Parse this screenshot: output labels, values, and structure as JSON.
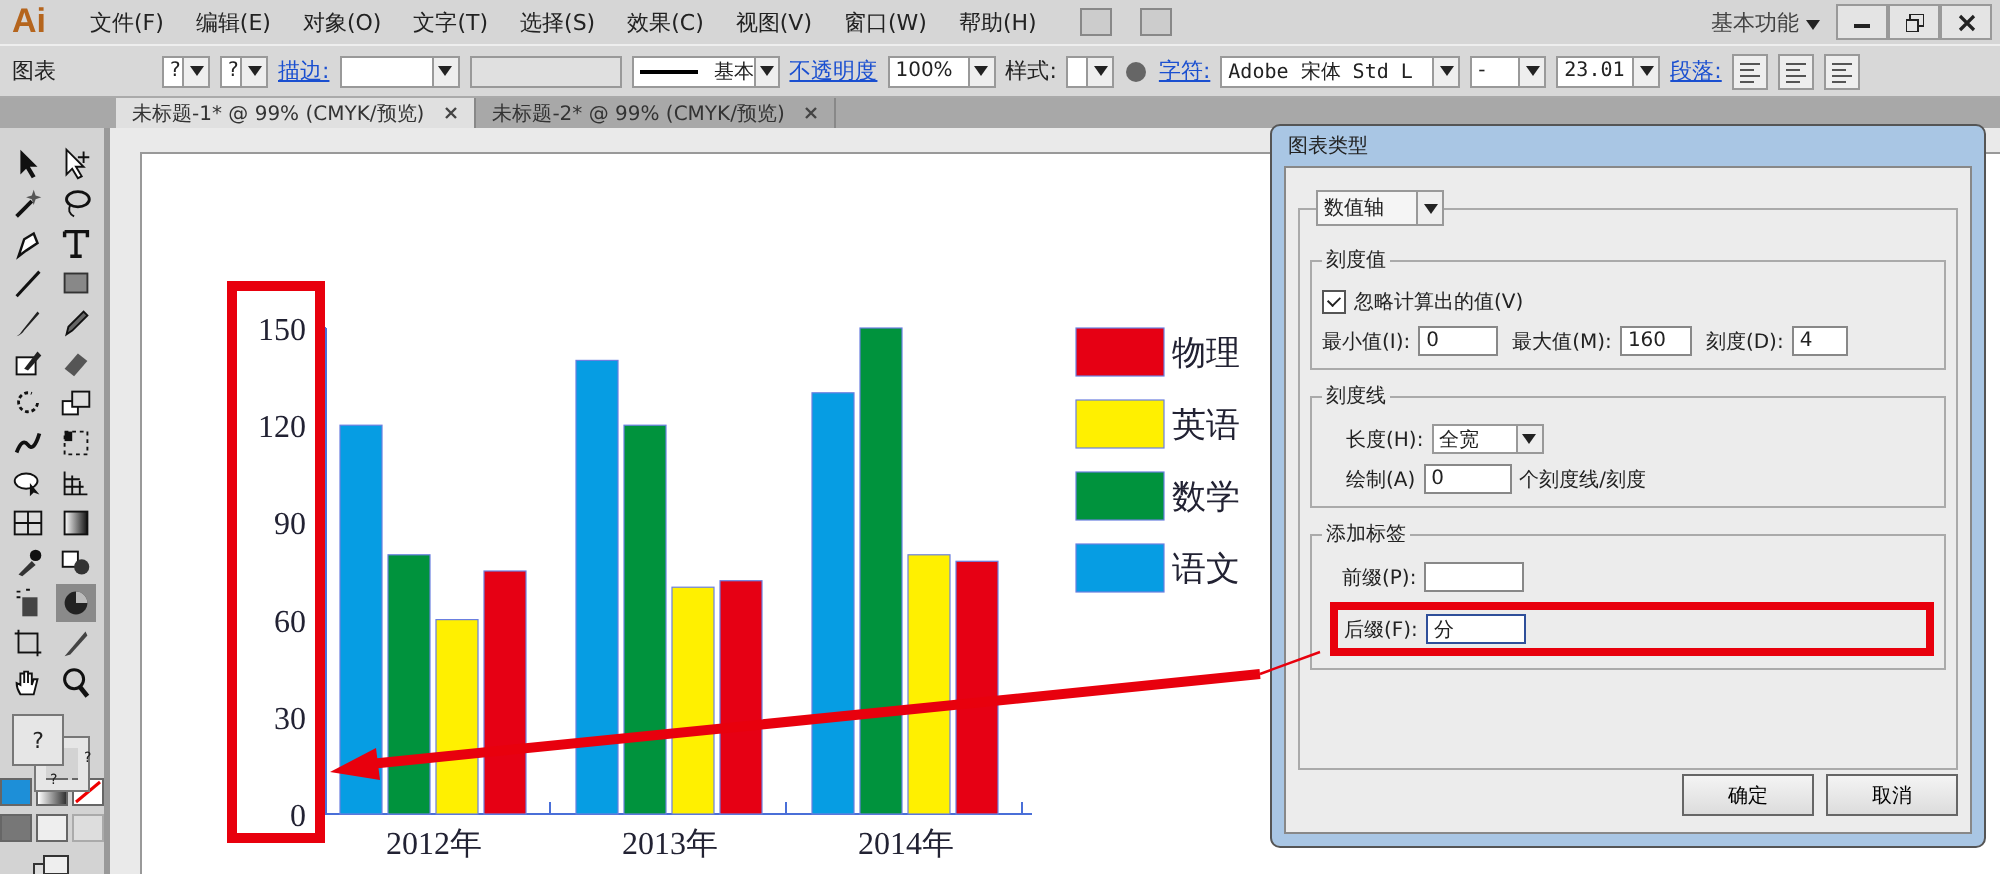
{
  "app": {
    "logo": "Ai",
    "menu": [
      "文件(F)",
      "编辑(E)",
      "对象(O)",
      "文字(T)",
      "选择(S)",
      "效果(C)",
      "视图(V)",
      "窗口(W)",
      "帮助(H)"
    ],
    "workspace": "基本功能"
  },
  "control_bar": {
    "object": "图表",
    "graph_menu_1": "?",
    "graph_menu_2": "?",
    "stroke_link": "描边:",
    "stroke_style": "基本",
    "opacity_link": "不透明度",
    "opacity": "100%",
    "style_label": "样式:",
    "char_link": "字符:",
    "font": "Adobe 宋体 Std L",
    "font_style": "-",
    "font_size": "23.01",
    "para_link": "段落:"
  },
  "tabs": [
    {
      "label": "未标题-1* @ 99% (CMYK/预览)",
      "selected": true
    },
    {
      "label": "未标题-2* @ 99% (CMYK/预览)",
      "selected": false
    }
  ],
  "tools": [
    {
      "kind": "selection",
      "selected": false
    },
    {
      "kind": "direct",
      "selected": false
    },
    {
      "kind": "wand",
      "selected": false
    },
    {
      "kind": "lasso",
      "selected": false
    },
    {
      "kind": "pen",
      "selected": false
    },
    {
      "kind": "type",
      "selected": false
    },
    {
      "kind": "line",
      "selected": false
    },
    {
      "kind": "rect",
      "selected": false
    },
    {
      "kind": "brush",
      "selected": false
    },
    {
      "kind": "pencil",
      "selected": false
    },
    {
      "kind": "blob",
      "selected": false
    },
    {
      "kind": "eraser",
      "selected": false
    },
    {
      "kind": "rotate",
      "selected": false
    },
    {
      "kind": "scale",
      "selected": false
    },
    {
      "kind": "warp",
      "selected": false
    },
    {
      "kind": "transform",
      "selected": false
    },
    {
      "kind": "builder",
      "selected": false
    },
    {
      "kind": "perspective",
      "selected": false
    },
    {
      "kind": "mesh",
      "selected": false
    },
    {
      "kind": "gradient",
      "selected": false
    },
    {
      "kind": "eyedropper",
      "selected": false
    },
    {
      "kind": "blend",
      "selected": false
    },
    {
      "kind": "sprayer",
      "selected": false
    },
    {
      "kind": "graph",
      "selected": true
    },
    {
      "kind": "artboard",
      "selected": false
    },
    {
      "kind": "slice",
      "selected": false
    },
    {
      "kind": "hand",
      "selected": false
    },
    {
      "kind": "zoom",
      "selected": false
    }
  ],
  "fill_stroke": {
    "fill": "?",
    "stroke_1": "?",
    "stroke_2": "?"
  },
  "chart": {
    "chart_data": {
      "type": "bar",
      "categories": [
        "2012年",
        "2013年",
        "2014年"
      ],
      "series": [
        {
          "name": "语文",
          "color": "#069de3",
          "values": [
            120,
            140,
            130
          ]
        },
        {
          "name": "数学",
          "color": "#00933d",
          "values": [
            80,
            120,
            150
          ]
        },
        {
          "name": "英语",
          "color": "#fff000",
          "values": [
            60,
            70,
            80
          ]
        },
        {
          "name": "物理",
          "color": "#e60014",
          "values": [
            75,
            72,
            78
          ]
        }
      ],
      "ylim": [
        0,
        150
      ],
      "yticks": [
        0,
        30,
        60,
        90,
        120,
        150
      ],
      "legend": "right"
    }
  },
  "dialog": {
    "title": "图表类型",
    "axis": "数值轴",
    "tick_values": {
      "title": "刻度值",
      "override_label": "忽略计算出的值(V)",
      "override_checked": true,
      "min_label": "最小值(I):",
      "min": "0",
      "max_label": "最大值(M):",
      "max": "160",
      "divisions_label": "刻度(D):",
      "divisions": "4"
    },
    "tick_marks": {
      "title": "刻度线",
      "length_label": "长度(H):",
      "length": "全宽",
      "draw_label": "绘制(A)",
      "draw": "0",
      "draw_unit": "个刻度线/刻度"
    },
    "labels": {
      "title": "添加标签",
      "prefix_label": "前缀(P):",
      "suffix_label": "后缀(F):",
      "suffix": "分"
    },
    "buttons": [
      "确定",
      "取消"
    ]
  }
}
